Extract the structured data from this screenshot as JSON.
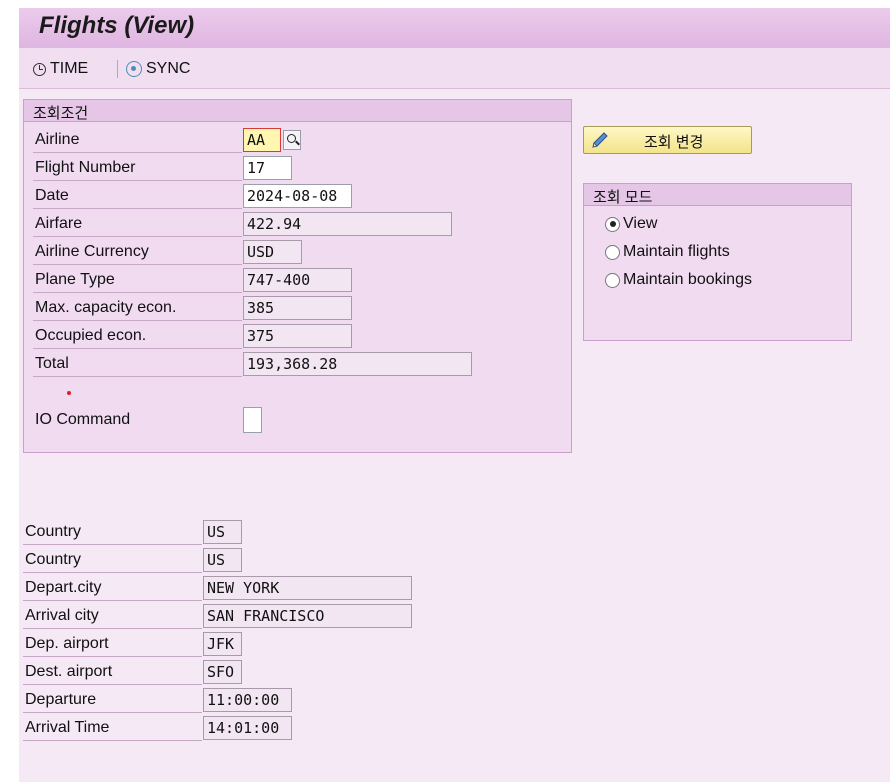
{
  "window": {
    "title": "Flights (View)"
  },
  "toolbar": {
    "time_label": "TIME",
    "sync_label": "SYNC"
  },
  "criteria": {
    "group_title": "조회조건",
    "airline": {
      "label": "Airline",
      "value": "AA"
    },
    "flight_number": {
      "label": "Flight Number",
      "value": "17"
    },
    "date": {
      "label": "Date",
      "value": "2024-08-08"
    },
    "airfare": {
      "label": "Airfare",
      "value": "422.94"
    },
    "currency": {
      "label": "Airline Currency",
      "value": "USD"
    },
    "plane_type": {
      "label": "Plane Type",
      "value": "747-400"
    },
    "max_capacity": {
      "label": "Max. capacity econ.",
      "value": "385"
    },
    "occupied": {
      "label": "Occupied econ.",
      "value": "375"
    },
    "total": {
      "label": "Total",
      "value": "193,368.28"
    },
    "io_command": {
      "label": "IO Command",
      "value": ""
    }
  },
  "change_button": {
    "label": "조회 변경"
  },
  "mode": {
    "group_title": "조회 모드",
    "options": [
      {
        "label": "View",
        "selected": true
      },
      {
        "label": "Maintain flights",
        "selected": false
      },
      {
        "label": "Maintain bookings",
        "selected": false
      }
    ]
  },
  "route": {
    "country_from": {
      "label": "Country",
      "value": "US"
    },
    "country_to": {
      "label": "Country",
      "value": "US"
    },
    "depart_city": {
      "label": "Depart.city",
      "value": "NEW YORK"
    },
    "arrival_city": {
      "label": "Arrival city",
      "value": "SAN FRANCISCO"
    },
    "dep_airport": {
      "label": "Dep. airport",
      "value": "JFK"
    },
    "dest_airport": {
      "label": "Dest. airport",
      "value": "SFO"
    },
    "departure": {
      "label": "Departure",
      "value": "11:00:00"
    },
    "arrival_time": {
      "label": "Arrival Time",
      "value": "14:01:00"
    }
  },
  "icons": {
    "time": "clock-icon",
    "sync": "sync-icon",
    "search_help": "magnifier-icon",
    "edit": "pencil-icon"
  },
  "colors": {
    "title_bar": "#dfb5e1",
    "background": "#f6e9f6",
    "focused_field": "#fff6b0",
    "focus_border": "#d83a3a",
    "button": "#f3e38a"
  }
}
